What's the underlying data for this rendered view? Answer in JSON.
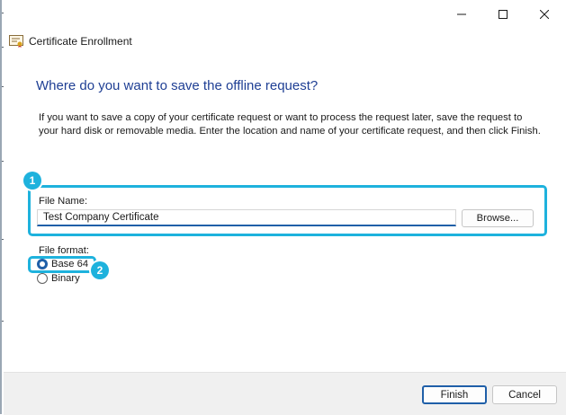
{
  "window": {
    "title": "Certificate Enrollment",
    "controls": {
      "minimize": "minimize-icon",
      "maximize": "maximize-icon",
      "close": "close-icon"
    }
  },
  "page": {
    "heading": "Where do you want to save the offline request?",
    "description": "If you want to save a copy of your certificate request or want to process the request later, save the request to your hard disk or removable media. Enter the location and name of your certificate request, and then click Finish."
  },
  "file_name": {
    "label": "File Name:",
    "value": "Test Company Certificate",
    "browse_label": "Browse..."
  },
  "file_format": {
    "label": "File format:",
    "options": [
      {
        "label": "Base 64",
        "selected": true
      },
      {
        "label": "Binary",
        "selected": false
      }
    ]
  },
  "callouts": [
    "1",
    "2"
  ],
  "footer": {
    "finish_label": "Finish",
    "cancel_label": "Cancel"
  },
  "colors": {
    "accent": "#1f5fa8",
    "heading": "#1f3f94",
    "callout": "#1eb2dd"
  }
}
